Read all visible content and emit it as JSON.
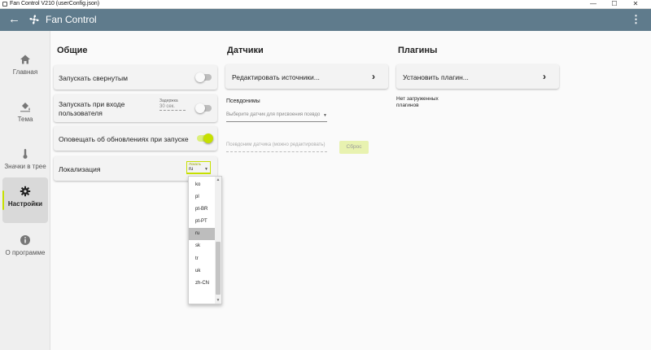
{
  "window": {
    "title": "Fan Control V210 (userConfig.json)",
    "minimize": "—",
    "maximize": "☐",
    "close": "✕"
  },
  "appbar": {
    "back_icon": "arrow-left-icon",
    "logo_icon": "fan-icon",
    "title": "Fan Control",
    "menu": "⋮"
  },
  "sidebar": {
    "items": [
      {
        "label": "Главная",
        "icon": "home-icon"
      },
      {
        "label": "Тема",
        "icon": "paint-bucket-icon"
      },
      {
        "label": "Значки в трее",
        "icon": "thermometer-icon"
      },
      {
        "label": "Настройки",
        "icon": "gear-icon",
        "active": true
      },
      {
        "label": "О программе",
        "icon": "info-icon"
      }
    ]
  },
  "general": {
    "title": "Общие",
    "start_minimized": {
      "label": "Запускать свернутым",
      "on": false
    },
    "start_with_login": {
      "label": "Запускать при входе пользователя",
      "delay_label": "Задержка",
      "delay_value": "30 сек.",
      "on": false
    },
    "update_notify": {
      "label": "Оповещать об обновлениях при запуске",
      "on": true
    },
    "localization": {
      "label": "Локализация",
      "select_label": "Локаль",
      "value": "ru",
      "caret": "▼"
    }
  },
  "sensors": {
    "title": "Датчики",
    "edit_sources": "Редактировать источники...",
    "aliases_label": "Псевдонимы",
    "sensor_select_placeholder": "Выберите датчик для присвоения псевдо",
    "caret": "▼",
    "alias_placeholder": "Псевдоним датчика (можно редактировать)",
    "reset_button": "Сброс"
  },
  "plugins": {
    "title": "Плагины",
    "install": "Установить плагин...",
    "no_plugins": "Нет загруженных плагинов"
  },
  "locale_dropdown": {
    "options": [
      "ko",
      "pl",
      "pt-BR",
      "pt-PT",
      "ru",
      "sk",
      "tr",
      "uk",
      "zh-CN"
    ],
    "selected": "ru",
    "scroll_up": "▲",
    "scroll_down": "▼"
  },
  "colors": {
    "appbar": "#5f7b8c",
    "accent": "#c6e000",
    "background": "#fafafa",
    "card": "#f3f3f3"
  }
}
